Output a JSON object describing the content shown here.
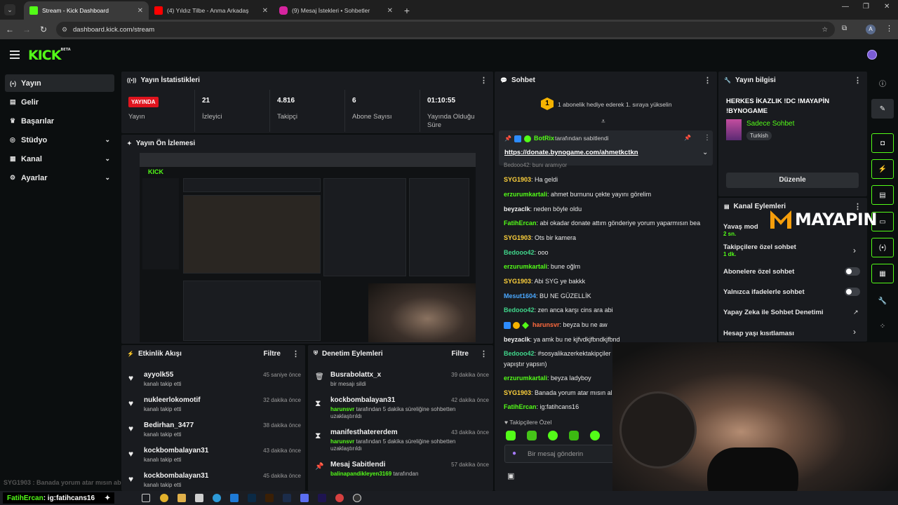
{
  "browser": {
    "tabs": [
      {
        "title": "Stream - Kick Dashboard",
        "color": "#53fc18",
        "glyph": "K"
      },
      {
        "title": "(4) Yıldız Tilbe - Anma Arkadaş",
        "color": "#ff0000",
        "glyph": "▶"
      },
      {
        "title": "(9) Mesaj İstekleri • Sohbetler",
        "color": "#d6249f",
        "glyph": "◎"
      }
    ],
    "url": "dashboard.kick.com/stream",
    "profile_initial": "A"
  },
  "logo": {
    "text": "KICK",
    "sup": "BETA"
  },
  "sidebar": {
    "items": [
      {
        "label": "Yayın",
        "icon": "((•))"
      },
      {
        "label": "Gelir",
        "icon": "▤"
      },
      {
        "label": "Başarılar",
        "icon": "🏆"
      },
      {
        "label": "Stüdyo",
        "icon": "⚙"
      },
      {
        "label": "Kanal",
        "icon": "◉"
      },
      {
        "label": "Ayarlar",
        "icon": "⚙"
      }
    ]
  },
  "stats": {
    "title": "Yayın İstatistikleri",
    "live_badge": "YAYINDA",
    "live_label": "Yayın",
    "cells": [
      {
        "value": "21",
        "label": "İzleyici"
      },
      {
        "value": "4.816",
        "label": "Takipçi"
      },
      {
        "value": "6",
        "label": "Abone Sayısı"
      },
      {
        "value": "01:10:55",
        "label": "Yayında Olduğu Süre"
      }
    ]
  },
  "preview": {
    "title": "Yayın Ön İzlemesi"
  },
  "activity": {
    "title": "Etkinlik Akışı",
    "filter": "Filtre",
    "rows": [
      {
        "name": "ayyolk55",
        "desc": "kanalı takip etti",
        "time": "45 saniye önce"
      },
      {
        "name": "nukleerlokomotif",
        "desc": "kanalı takip etti",
        "time": "32 dakika önce"
      },
      {
        "name": "Bedirhan_3477",
        "desc": "kanalı takip etti",
        "time": "38 dakika önce"
      },
      {
        "name": "kockbombalayan31",
        "desc": "kanalı takip etti",
        "time": "43 dakika önce"
      },
      {
        "name": "kockbombalayan31",
        "desc": "kanalı takip etti",
        "time": "45 dakika önce"
      }
    ]
  },
  "moderation": {
    "title": "Denetim Eylemleri",
    "filter": "Filtre",
    "rows": [
      {
        "name": "Busrabolattx_x",
        "actor": "",
        "desc": "bir mesajı sildi",
        "time": "39 dakika önce",
        "icon": "🗑"
      },
      {
        "name": "kockbombalayan31",
        "actor": "harunsvr",
        "desc": "tarafından 5 dakika süreliğine sohbetten uzaklaştırıldı",
        "time": "42 dakika önce",
        "icon": "⧗"
      },
      {
        "name": "manifesthatererdem",
        "actor": "harunsvr",
        "desc": "tarafından 5 dakika süreliğine sohbetten uzaklaştırıldı",
        "time": "43 dakika önce",
        "icon": "⧗"
      },
      {
        "name": "Mesaj Sabitlendi",
        "actor": "balinapandikleyen3169",
        "desc": "tarafından",
        "time": "57 dakika önce",
        "icon": "📌"
      }
    ]
  },
  "chat": {
    "title": "Sohbet",
    "gift_text": "1 abonelik hediye ederek 1. sıraya yükselin",
    "gift_rank": "1",
    "pinned_by": "BotRix",
    "pinned_suffix": "tarafından sabitlendi",
    "pinned_link": "https://donate.bynogame.com/ahmetkctkn",
    "messages": [
      {
        "user": "SYG1903",
        "color": "u-yel",
        "text": "Ha geldi"
      },
      {
        "user": "erzurumkartali",
        "color": "u-grn",
        "text": "ahmet burnunu çekte yayını görelim"
      },
      {
        "user": "beyzaclk",
        "color": "u-wht",
        "text": "neden böyle oldu"
      },
      {
        "user": "FatihErcan",
        "color": "u-grn",
        "text": "abi okadar donate attım gönderiye yorum yaparmısın bea"
      },
      {
        "user": "SYG1903",
        "color": "u-yel",
        "text": "Ots bir kamera"
      },
      {
        "user": "Bedooo42",
        "color": "u-grn2",
        "text": "ooo"
      },
      {
        "user": "erzurumkartali",
        "color": "u-grn",
        "text": "bune oğlm"
      },
      {
        "user": "SYG1903",
        "color": "u-yel",
        "text": "Abi SYG ye bakkk"
      },
      {
        "user": "Mesut1604",
        "color": "u-blu",
        "text": "BU NE GÜZELLİK"
      },
      {
        "user": "Bedooo42",
        "color": "u-grn2",
        "text": "zen anca karşı cins ara abi"
      },
      {
        "user": "harunsvr",
        "color": "u-red",
        "text": "beyza bu ne aw"
      },
      {
        "user": "beyzaclk",
        "color": "u-wht",
        "text": "ya amk bu ne kjfvdkjfbndkjfbnd"
      },
      {
        "user": "Bedooo42",
        "color": "u-grn2",
        "text": "#sosyalikazerkektakipçiler"
      },
      {
        "user": "",
        "color": "u-wht",
        "text": "yapıştır yapsın)"
      },
      {
        "user": "erzurumkartali",
        "color": "u-grn",
        "text": "beyza ladyboy"
      },
      {
        "user": "SYG1903",
        "color": "u-yel",
        "text": "Banada yorum atar mısın ab"
      },
      {
        "user": "FatihErcan",
        "color": "u-grn",
        "text": "ig:fatihcans16"
      }
    ],
    "partial_top": "Bedooo42: bunı aramıyor",
    "followers_only": "Takipçilere Özel",
    "input_placeholder": "Bir mesaj gönderin"
  },
  "stream_info": {
    "title": "Yayın bilgisi",
    "stream_title": "HERKES İKAZLIK !DC !MAYAPİN !BYNOGAME",
    "category": "Sadece Sohbet",
    "tag": "Turkish",
    "edit_button": "Düzenle"
  },
  "channel_actions": {
    "title": "Kanal Eylemleri",
    "slow_mode": "Yavaş mod",
    "slow_value": "2 sn.",
    "followers_chat": "Takipçilere özel sohbet",
    "followers_value": "1 dk.",
    "subs_chat": "Abonelere özel sohbet",
    "emote_chat": "Yalnızca ifadelerle sohbet",
    "ai_mod": "Yapay Zeka ile Sohbet Denetimi",
    "age_limit": "Hesap yaşı kısıtlaması"
  },
  "overlay": {
    "brand": "MAYAPIN",
    "ticker_user": "FatihErcan",
    "ticker_text": ": ig:fatihcans16",
    "ticker_ghost": "SYG1903 : Banada yorum atar mısın ab"
  }
}
